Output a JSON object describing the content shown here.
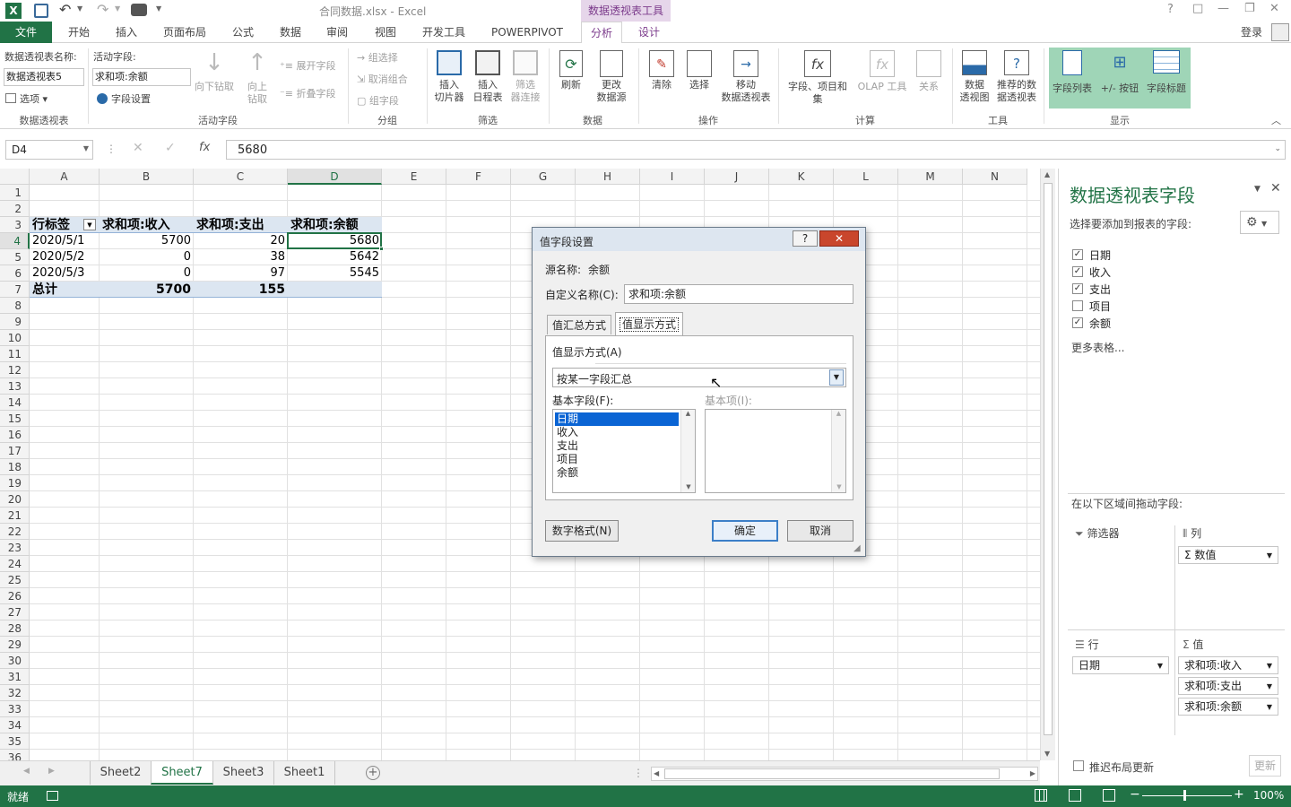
{
  "titlebar": {
    "doc_title": "合同数据.xlsx - Excel",
    "context_tool": "数据透视表工具",
    "buttons": [
      "?",
      "□",
      "—",
      "❐",
      "✕"
    ]
  },
  "ribbon_tabs": {
    "file": "文件",
    "items": [
      "开始",
      "插入",
      "页面布局",
      "公式",
      "数据",
      "审阅",
      "视图",
      "开发工具",
      "POWERPIVOT",
      "分析",
      "设计"
    ],
    "login": "登录"
  },
  "ribbon": {
    "pivot_name_label": "数据透视表名称:",
    "pivot_name_value": "数据透视表5",
    "options_label": "选项",
    "group_pivot": "数据透视表",
    "active_field_label": "活动字段:",
    "active_field_value": "求和项:余额",
    "field_settings": "字段设置",
    "drill_down": "向下钻取",
    "drill_up": "向上钻取",
    "expand_field": "展开字段",
    "collapse_field": "折叠字段",
    "group_active": "活动字段",
    "group_selection": "组选择",
    "ungroup": "取消组合",
    "group_field": "组字段",
    "group_group": "分组",
    "insert_slicer": "插入\n切片器",
    "insert_timeline": "插入\n日程表",
    "filter_conn": "筛选\n器连接",
    "group_filter": "筛选",
    "refresh": "刷新",
    "change_source": "更改\n数据源",
    "group_data": "数据",
    "clear": "清除",
    "select": "选择",
    "move_pivot": "移动\n数据透视表",
    "group_actions": "操作",
    "fields_items": "字段、项目和\n集",
    "olap": "OLAP 工具",
    "relations": "关系",
    "group_calc": "计算",
    "pivot_chart": "数据\n透视图",
    "recommended": "推荐的数\n据透视表",
    "group_tools": "工具",
    "field_list": "字段列表",
    "plus_minus": "+/- 按钮",
    "field_headers": "字段标题",
    "group_show": "显示"
  },
  "formula_bar": {
    "name_box": "D4",
    "fx": "fx",
    "value": "5680"
  },
  "grid": {
    "columns": [
      "A",
      "B",
      "C",
      "D",
      "E",
      "F",
      "G",
      "H",
      "I",
      "J",
      "K",
      "L",
      "M",
      "N"
    ],
    "rows": [
      "1",
      "2",
      "3",
      "4",
      "5",
      "6",
      "7",
      "8",
      "9",
      "10",
      "11",
      "12",
      "13",
      "14",
      "15",
      "16",
      "17",
      "18",
      "19",
      "20",
      "21",
      "22",
      "23",
      "24",
      "25",
      "26",
      "27",
      "28",
      "29",
      "30",
      "31",
      "32",
      "33",
      "34",
      "35",
      "36"
    ],
    "header": [
      "行标签",
      "求和项:收入",
      "求和项:支出",
      "求和项:余额"
    ],
    "data": [
      [
        "2020/5/1",
        "5700",
        "20",
        "5680"
      ],
      [
        "2020/5/2",
        "0",
        "38",
        "5642"
      ],
      [
        "2020/5/3",
        "0",
        "97",
        "5545"
      ]
    ],
    "total": [
      "总计",
      "5700",
      "155",
      ""
    ]
  },
  "dialog": {
    "title": "值字段设置",
    "help": "?",
    "source_label": "源名称:",
    "source_value": "余额",
    "custom_name_label": "自定义名称(C):",
    "custom_name_value": "求和项:余额",
    "tab_summarize": "值汇总方式",
    "tab_show_as": "值显示方式",
    "show_as_label": "值显示方式(A)",
    "show_as_value": "按某一字段汇总",
    "base_field_label": "基本字段(F):",
    "base_item_label": "基本项(I):",
    "base_fields": [
      "日期",
      "收入",
      "支出",
      "项目",
      "余额"
    ],
    "number_format": "数字格式(N)",
    "ok": "确定",
    "cancel": "取消"
  },
  "sheets": {
    "tabs": [
      "Sheet2",
      "Sheet7",
      "Sheet3",
      "Sheet1"
    ],
    "active": "Sheet7"
  },
  "panel": {
    "title": "数据透视表字段",
    "choose_label": "选择要添加到报表的字段:",
    "fields": [
      {
        "name": "日期",
        "checked": true
      },
      {
        "name": "收入",
        "checked": true
      },
      {
        "name": "支出",
        "checked": true
      },
      {
        "name": "项目",
        "checked": false
      },
      {
        "name": "余额",
        "checked": true
      }
    ],
    "more_tables": "更多表格...",
    "drag_label": "在以下区域间拖动字段:",
    "filters_label": "筛选器",
    "columns_label": "列",
    "columns_item": "Σ 数值",
    "rows_label": "行",
    "rows_item": "日期",
    "values_label": "值",
    "values_items": [
      "求和项:收入",
      "求和项:支出",
      "求和项:余额"
    ],
    "defer_label": "推迟布局更新",
    "update_button": "更新"
  },
  "status": {
    "ready": "就绪",
    "zoom": "100%"
  },
  "colors": {
    "excel_green": "#217346",
    "context_tab": "#e6d6ea",
    "context_text": "#7b3a8b",
    "pivot_row_fill": "#dce6f1",
    "selected_blue": "#0a64d4"
  }
}
